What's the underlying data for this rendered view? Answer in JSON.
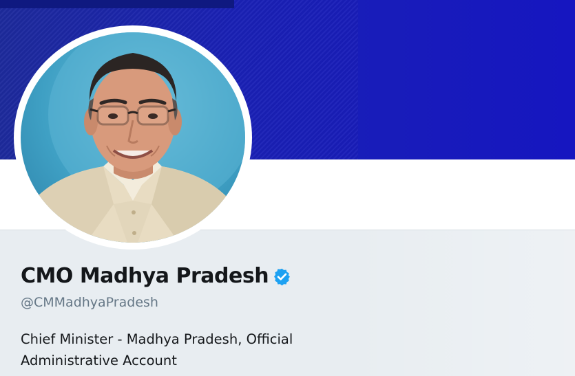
{
  "profile": {
    "display_name": "CMO Madhya Pradesh",
    "handle": "@CMMadhyaPradesh",
    "bio_line1": "Chief Minister - Madhya Pradesh, Official",
    "bio_line2": "Administrative Account",
    "verified": true
  },
  "icons": {
    "verified": "verified-badge-icon"
  },
  "colors": {
    "banner": "#1a21b5",
    "verified_blue": "#1da1f2",
    "name_text": "#14171a",
    "handle_text": "#657786",
    "info_background": "#e8edf1"
  }
}
